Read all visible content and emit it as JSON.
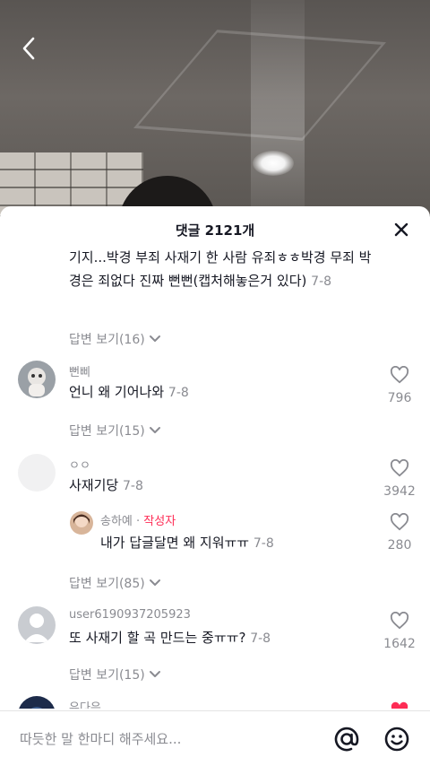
{
  "sheet": {
    "title": "댓글 2121개"
  },
  "partial_comment": {
    "text": "기지...박경 부죄 사재기 한 사람 유죄ㅎㅎ박경 무죄 박경은 죄없다 진짜 뻔뻔(캡처해놓은거 있다)",
    "date": "7-8",
    "replies_label": "답변 보기(16)"
  },
  "comments": [
    {
      "username": "뻔삐",
      "text": "언니 왜 기어나와",
      "date": "7-8",
      "likes": "796",
      "replies_label": "답변 보기(15)"
    },
    {
      "username": "ㅇㅇ",
      "text": "사재기당",
      "date": "7-8",
      "likes": "3942",
      "reply": {
        "username": "송하예",
        "author_tag": "작성자",
        "text": "내가 답글달면 왜 지워ㅠㅠ",
        "date": "7-8",
        "likes": "280"
      },
      "replies_label": "답변 보기(85)"
    },
    {
      "username": "user6190937205923",
      "text": "또 사재기 할 곡 만드는 중ㅠㅠ?",
      "date": "7-8",
      "likes": "1642",
      "replies_label": "답변 보기(15)"
    },
    {
      "username": "유다은"
    }
  ],
  "footer": {
    "placeholder": "따듯한 말 한마디 해주세요..."
  },
  "colors": {
    "author": "#fe2c55",
    "secondary_text": "#8a8b91",
    "primary_text": "#161823"
  }
}
